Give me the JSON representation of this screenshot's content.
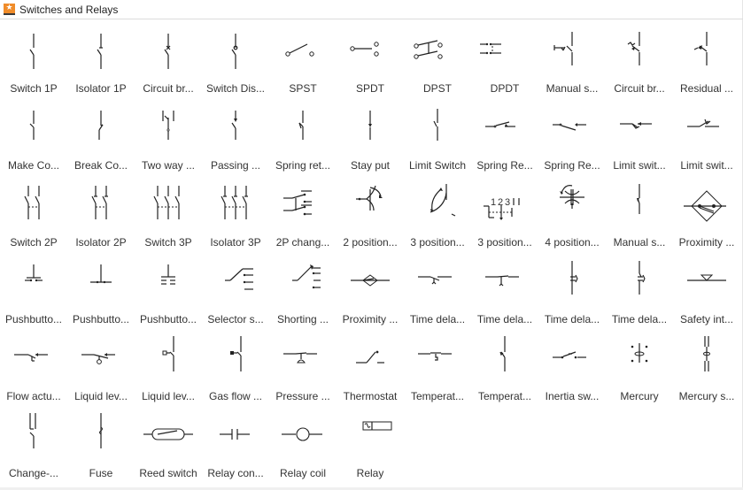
{
  "library": {
    "title": "Switches and Relays",
    "icon": "star-library-icon",
    "accent_color": "#f08c2a"
  },
  "shapes": [
    {
      "label": "Switch 1P",
      "icon": "switch-1p"
    },
    {
      "label": "Isolator 1P",
      "icon": "isolator-1p"
    },
    {
      "label": "Circuit br...",
      "icon": "circuit-breaker"
    },
    {
      "label": "Switch Dis...",
      "icon": "switch-disconnector"
    },
    {
      "label": "SPST",
      "icon": "spst"
    },
    {
      "label": "SPDT",
      "icon": "spdt"
    },
    {
      "label": "DPST",
      "icon": "dpst"
    },
    {
      "label": "DPDT",
      "icon": "dpdt"
    },
    {
      "label": "Manual s...",
      "icon": "manual-switch"
    },
    {
      "label": "Circuit br...",
      "icon": "circuit-breaker-thermal"
    },
    {
      "label": "Residual ...",
      "icon": "residual-current"
    },
    {
      "label": "Make Co...",
      "icon": "make-contact"
    },
    {
      "label": "Break Co...",
      "icon": "break-contact"
    },
    {
      "label": "Two way ...",
      "icon": "two-way"
    },
    {
      "label": "Passing ...",
      "icon": "passing-contact"
    },
    {
      "label": "Spring ret...",
      "icon": "spring-return"
    },
    {
      "label": "Stay put",
      "icon": "stay-put"
    },
    {
      "label": "Limit Switch",
      "icon": "limit-switch"
    },
    {
      "label": "Spring Re...",
      "icon": "spring-return-h1"
    },
    {
      "label": "Spring Re...",
      "icon": "spring-return-h2"
    },
    {
      "label": "Limit swit...",
      "icon": "limit-switch-h1"
    },
    {
      "label": "Limit swit...",
      "icon": "limit-switch-h2"
    },
    {
      "label": "Switch 2P",
      "icon": "switch-2p"
    },
    {
      "label": "Isolator 2P",
      "icon": "isolator-2p"
    },
    {
      "label": "Switch 3P",
      "icon": "switch-3p"
    },
    {
      "label": "Isolator 3P",
      "icon": "isolator-3p"
    },
    {
      "label": "2P chang...",
      "icon": "changeover-2p"
    },
    {
      "label": "2 position...",
      "icon": "position-2"
    },
    {
      "label": "3 position...",
      "icon": "position-3a"
    },
    {
      "label": "3 position...",
      "icon": "position-3b"
    },
    {
      "label": "4 position...",
      "icon": "position-4"
    },
    {
      "label": "Manual s...",
      "icon": "manual-switch-2"
    },
    {
      "label": "Proximity ...",
      "icon": "proximity-diamond"
    },
    {
      "label": "Pushbutto...",
      "icon": "pushbutton-1"
    },
    {
      "label": "Pushbutto...",
      "icon": "pushbutton-2"
    },
    {
      "label": "Pushbutto...",
      "icon": "pushbutton-3"
    },
    {
      "label": "Selector s...",
      "icon": "selector-switch"
    },
    {
      "label": "Shorting ...",
      "icon": "shorting-selector"
    },
    {
      "label": "Proximity ...",
      "icon": "proximity-h"
    },
    {
      "label": "Time dela...",
      "icon": "time-delay-1"
    },
    {
      "label": "Time dela...",
      "icon": "time-delay-2"
    },
    {
      "label": "Time dela...",
      "icon": "time-delay-3"
    },
    {
      "label": "Time dela...",
      "icon": "time-delay-4"
    },
    {
      "label": "Safety int...",
      "icon": "safety-interlock"
    },
    {
      "label": "Flow actu...",
      "icon": "flow-actuated"
    },
    {
      "label": "Liquid lev...",
      "icon": "liquid-level-1"
    },
    {
      "label": "Liquid lev...",
      "icon": "liquid-level-2"
    },
    {
      "label": "Gas flow ...",
      "icon": "gas-flow"
    },
    {
      "label": "Pressure ...",
      "icon": "pressure"
    },
    {
      "label": "Thermostat",
      "icon": "thermostat"
    },
    {
      "label": "Temperat...",
      "icon": "temperature-1"
    },
    {
      "label": "Temperat...",
      "icon": "temperature-2"
    },
    {
      "label": "Inertia sw...",
      "icon": "inertia-switch"
    },
    {
      "label": "Mercury",
      "icon": "mercury"
    },
    {
      "label": "Mercury s...",
      "icon": "mercury-switch"
    },
    {
      "label": "Change-...",
      "icon": "change-over"
    },
    {
      "label": "Fuse",
      "icon": "fuse"
    },
    {
      "label": "Reed switch",
      "icon": "reed-switch"
    },
    {
      "label": "Relay con...",
      "icon": "relay-contact"
    },
    {
      "label": "Relay coil",
      "icon": "relay-coil"
    },
    {
      "label": "Relay",
      "icon": "relay"
    }
  ]
}
